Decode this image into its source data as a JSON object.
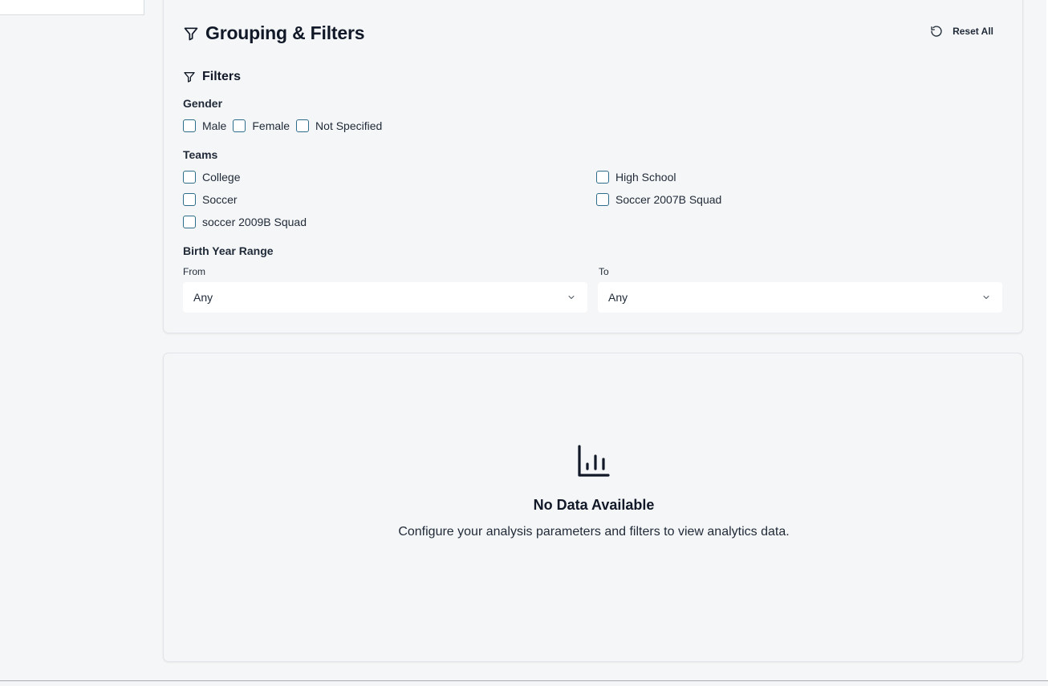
{
  "filters_card": {
    "title": "Grouping & Filters",
    "reset_label": "Reset All",
    "filters_title": "Filters",
    "gender": {
      "label": "Gender",
      "options": [
        "Male",
        "Female",
        "Not Specified"
      ]
    },
    "teams": {
      "label": "Teams",
      "options": [
        "College",
        "High School",
        "Soccer",
        "Soccer 2007B Squad",
        "soccer 2009B Squad"
      ]
    },
    "birth_year": {
      "label": "Birth Year Range",
      "from_label": "From",
      "from_value": "Any",
      "to_label": "To",
      "to_value": "Any"
    }
  },
  "empty_state": {
    "icon": "bar-chart-icon",
    "title": "No Data Available",
    "description": "Configure your analysis parameters and filters to view analytics data."
  },
  "colors": {
    "checkbox_border": "#2d6c8a",
    "background": "#f5f6f7"
  }
}
